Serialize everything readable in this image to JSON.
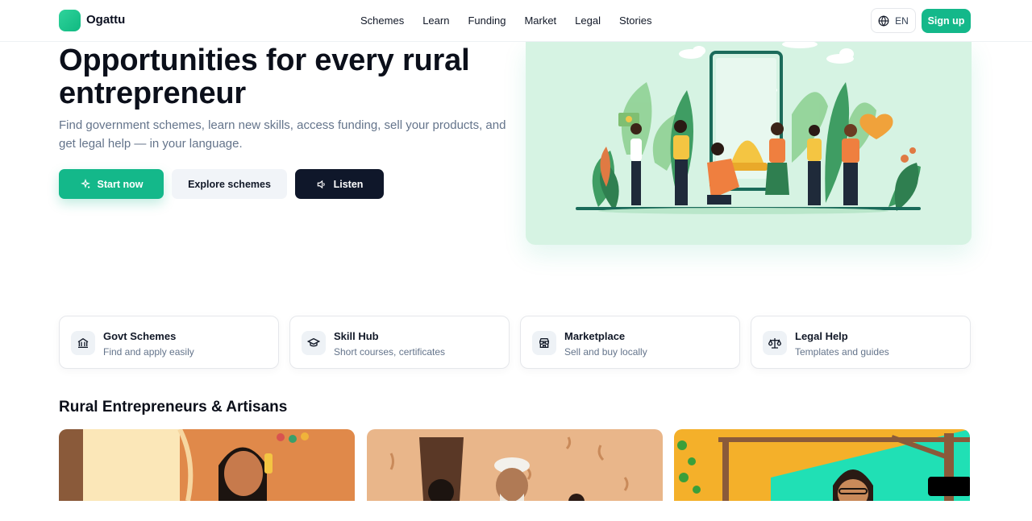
{
  "brand": {
    "name": "Ogattu",
    "accent": "#14b88a"
  },
  "nav": {
    "items": [
      "Schemes",
      "Learn",
      "Funding",
      "Market",
      "Legal",
      "Stories"
    ]
  },
  "header": {
    "lang_label": "EN",
    "signup_label": "Sign up"
  },
  "hero": {
    "title": "Opportunities for every rural entrepreneur",
    "subtitle": "Find government schemes, learn new skills, access funding, sell your products, and get legal help — in your language.",
    "buttons": {
      "start": "Start now",
      "explore": "Explore schemes",
      "listen": "Listen"
    }
  },
  "features": [
    {
      "title": "Govt Schemes",
      "subtitle": "Find and apply easily",
      "icon": "bank-icon"
    },
    {
      "title": "Skill Hub",
      "subtitle": "Short courses, certificates",
      "icon": "graduation-cap-icon"
    },
    {
      "title": "Marketplace",
      "subtitle": "Sell and buy locally",
      "icon": "store-icon"
    },
    {
      "title": "Legal Help",
      "subtitle": "Templates and guides",
      "icon": "scale-icon"
    }
  ],
  "stories": {
    "section_title": "Rural Entrepreneurs & Artisans"
  }
}
